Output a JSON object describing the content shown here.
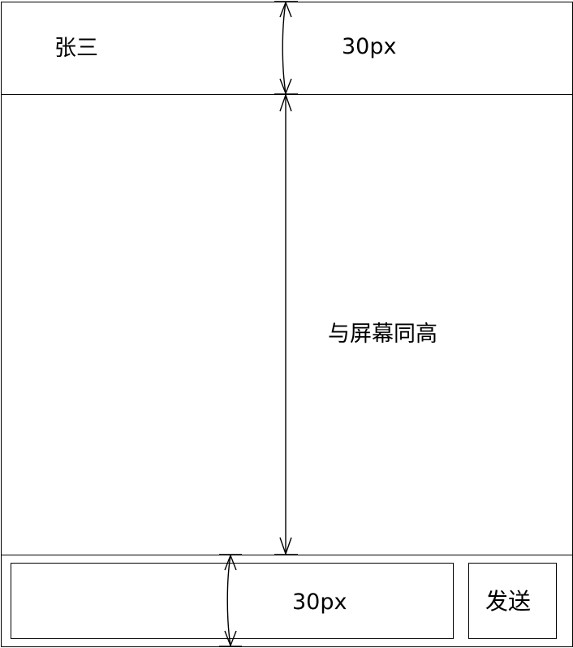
{
  "header": {
    "contact_name": "张三",
    "height_label": "30px"
  },
  "chat_area": {
    "height_label": "与屏幕同高"
  },
  "footer": {
    "height_label": "30px",
    "send_label": "发送"
  },
  "colors": {
    "line": "#000000",
    "background": "#ffffff"
  },
  "icons": {
    "top_dimension": "double-arrow-vertical-icon",
    "chat_dimension": "double-arrow-vertical-icon",
    "bottom_dimension": "double-arrow-vertical-icon"
  }
}
